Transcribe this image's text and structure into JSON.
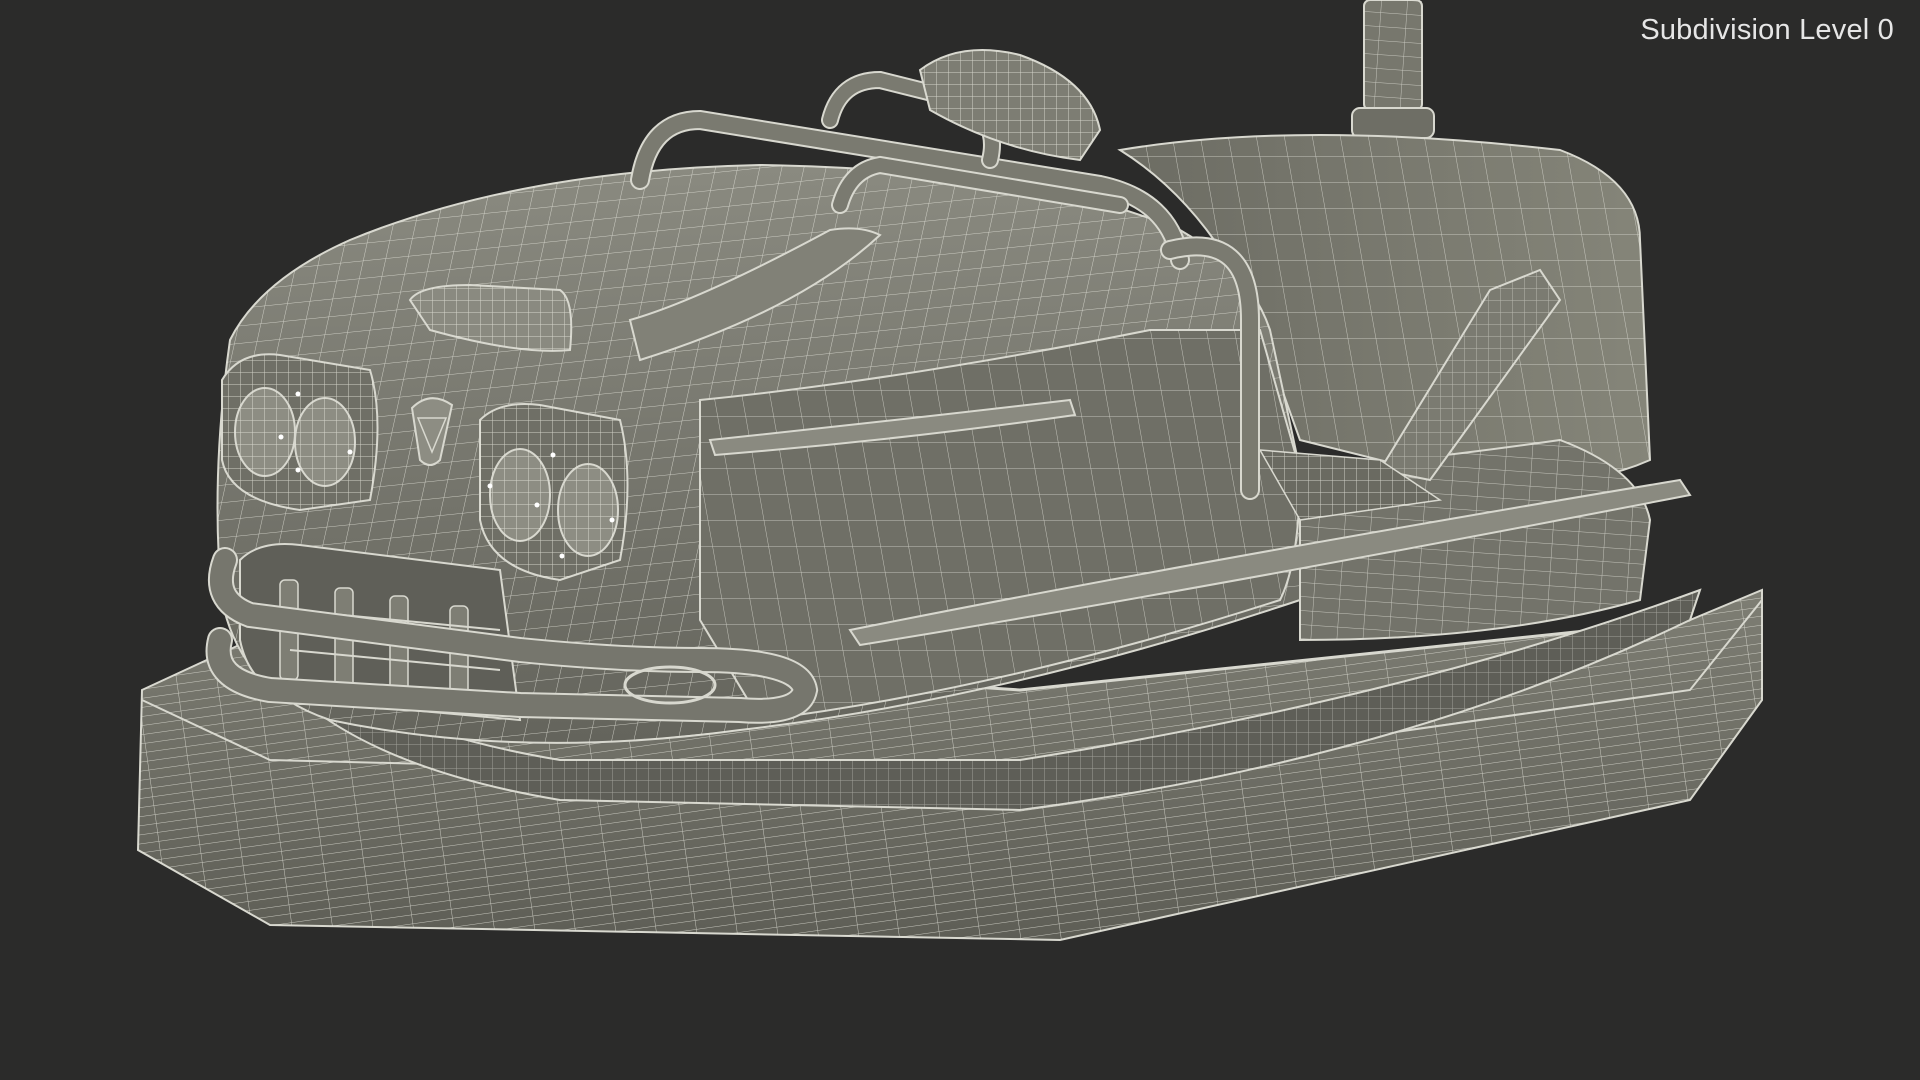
{
  "viewport": {
    "label": "Subdivision Level 0",
    "background_color": "#2b2b2a",
    "mesh_fill_color": "#7a7a70",
    "wire_color": "#e8e8e0"
  },
  "model": {
    "name": "bumper-car-wireframe"
  }
}
